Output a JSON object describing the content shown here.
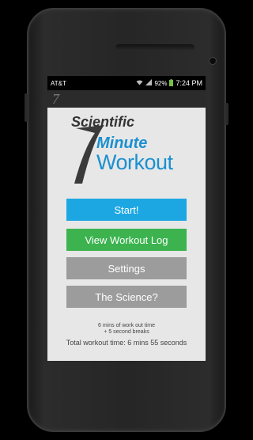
{
  "status": {
    "carrier": "AT&T",
    "battery": "92%",
    "time": "7:24 PM"
  },
  "actionbar": {
    "icon_glyph": "7"
  },
  "logo": {
    "scientific": "Scientific",
    "minute": "Minute",
    "workout": "Workout"
  },
  "buttons": {
    "start": "Start!",
    "log": "View Workout Log",
    "settings": "Settings",
    "science": "The Science?"
  },
  "info": {
    "line1": "6 mins of work out time",
    "line2": "+ 5 second breaks",
    "total": "Total workout time: 6 mins 55 seconds"
  },
  "colors": {
    "start": "#1da7e2",
    "log": "#3cb34f",
    "neutral": "#9c9c9c",
    "brand_blue": "#1b90d0"
  }
}
